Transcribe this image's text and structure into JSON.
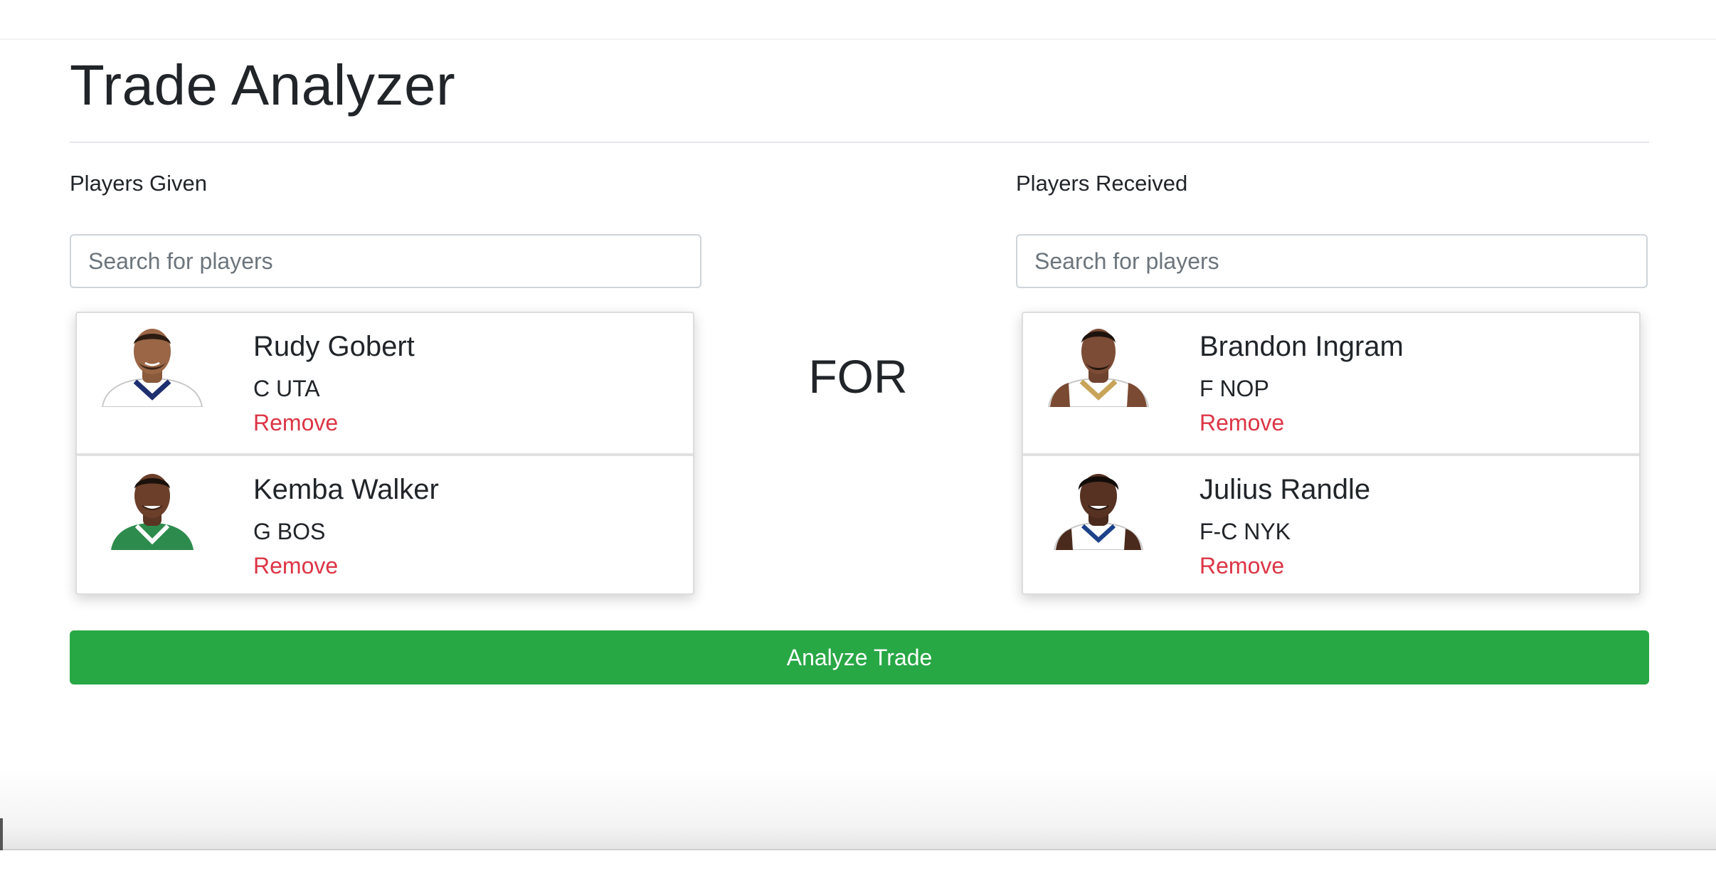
{
  "page": {
    "title": "Trade Analyzer",
    "connector_label": "FOR"
  },
  "given": {
    "label": "Players Given",
    "search_placeholder": "Search for players",
    "players": [
      {
        "name": "Rudy Gobert",
        "position_team": "C UTA",
        "remove_label": "Remove",
        "jersey_color": "#ffffff",
        "trim_color": "#1d2f6f"
      },
      {
        "name": "Kemba Walker",
        "position_team": "G BOS",
        "remove_label": "Remove",
        "jersey_color": "#2e8b4e",
        "trim_color": "#ffffff"
      }
    ]
  },
  "received": {
    "label": "Players Received",
    "search_placeholder": "Search for players",
    "players": [
      {
        "name": "Brandon Ingram",
        "position_team": "F NOP",
        "remove_label": "Remove",
        "jersey_color": "#ffffff",
        "trim_color": "#c8a45a"
      },
      {
        "name": "Julius Randle",
        "position_team": "F-C NYK",
        "remove_label": "Remove",
        "jersey_color": "#ffffff",
        "trim_color": "#1d428a"
      }
    ]
  },
  "actions": {
    "analyze_label": "Analyze Trade"
  },
  "colors": {
    "remove": "#dc3545",
    "analyze_button": "#28a745",
    "text": "#212529"
  }
}
